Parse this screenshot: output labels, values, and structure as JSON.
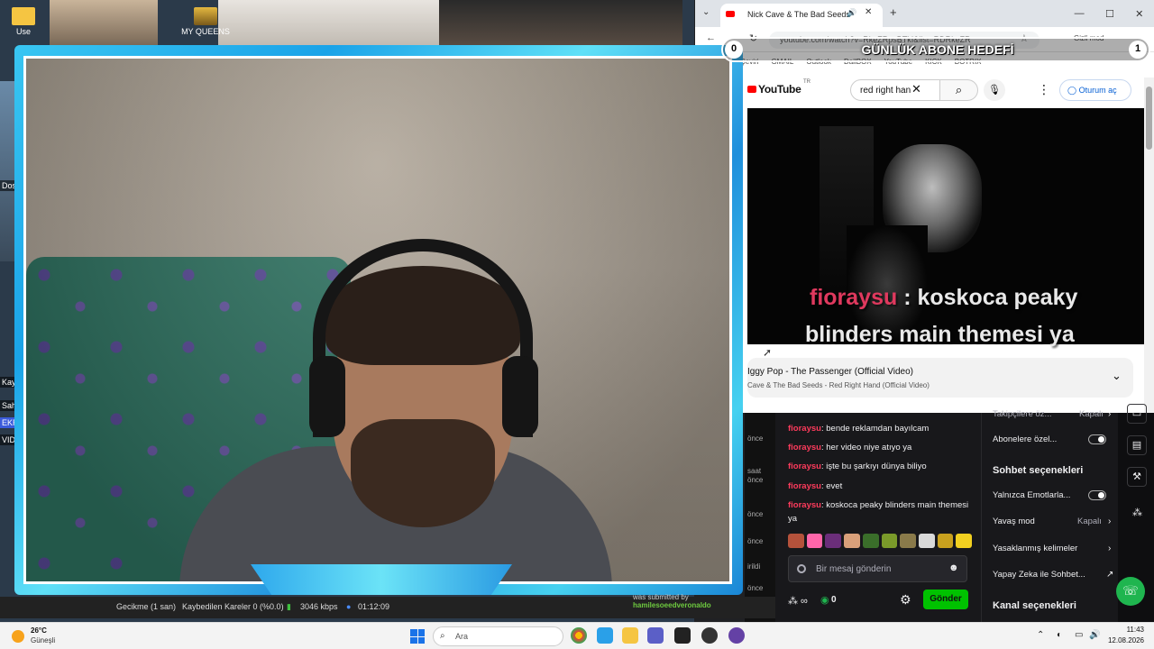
{
  "desktop": {
    "icons": [
      {
        "label": "Use",
        "icon": "folder-icon"
      },
      {
        "label": "MY QUEENS",
        "icon": "folder-image-icon"
      }
    ],
    "left_labels": [
      "Dosy",
      "Kay",
      "Sah",
      "EKR",
      "VIDE"
    ]
  },
  "browser": {
    "tab_title": "Nick Cave & The Bad Seeds",
    "url": "youtube.com/watch?v=RkeZRpsBTkI&list=RDRkeZR",
    "bookmarks": [
      "Çeviri",
      "GMAIL",
      "Outlook",
      "DailBOX",
      "YouTube",
      "KICK",
      "BOTRIX"
    ],
    "profile_label": "Gizli mod",
    "youtube": {
      "logo": "YouTube",
      "region": "TR",
      "search_value": "red right han",
      "signin_label": "Oturum aç"
    },
    "playlist": {
      "title": "Iggy Pop - The Passenger (Official Video)",
      "subtitle": "Cave & The Bad Seeds - Red Right Hand (Official Video)"
    }
  },
  "overlay": {
    "goal_title": "GÜNLÜK ABONE HEDEFİ",
    "goal_current": "0",
    "goal_target": "1",
    "caption_user": "fioraysu",
    "caption_line1": " : koskoca peaky",
    "caption_line2": "blinders main themesi ya"
  },
  "chat": {
    "timestamps": [
      "önce",
      "saat önce",
      "önce",
      "önce",
      "irildi",
      "önce"
    ],
    "messages": [
      {
        "user": "fioraysu",
        "text": ": bende reklamdan bayılcam"
      },
      {
        "user": "fioraysu",
        "text": ": her video niye atıyo ya"
      },
      {
        "user": "fioraysu",
        "text": ": işte bu şarkıyı dünya biliyo"
      },
      {
        "user": "fioraysu",
        "text": ": evet"
      },
      {
        "user": "fioraysu",
        "text": ": koskoca peaky blinders main themesi ya"
      }
    ],
    "input_placeholder": "Bir mesaj gönderin",
    "points": "0",
    "send_label": "Gönder",
    "emote_colors": [
      "#b5523b",
      "#ff66aa",
      "#6b2e7a",
      "#d9a07a",
      "#3a6e2a",
      "#7a9a2a",
      "#8a7a4a",
      "#d9d9d9",
      "#c9a11e",
      "#f2d020"
    ]
  },
  "settings": {
    "row_followers": "Takipçilere öz...",
    "row_followers_value": "Kapalı",
    "row_subscribers": "Abonelere özel...",
    "chat_options_title": "Sohbet seçenekleri",
    "emote_only": "Yalnızca Emotlarla...",
    "slow_mode": "Yavaş mod",
    "slow_mode_value": "Kapalı",
    "banned_words": "Yasaklanmış kelimeler",
    "ai_chat": "Yapay Zeka ile Sohbet...",
    "channel_options_title": "Kanal seçenekleri"
  },
  "obs": {
    "delay": "Gecikme (1 san)",
    "dropped": "Kaybedilen Kareler 0 (%0.0)",
    "bitrate": "3046 kbps",
    "time": "01:12:09",
    "submitted_label": "was submitted by",
    "submitted_user": "hamilesoeedveronaldo"
  },
  "taskbar": {
    "weather_temp": "26°C",
    "weather_condition": "Güneşli",
    "search_placeholder": "Ara",
    "time": "11:43",
    "date": "12.08.2026"
  }
}
